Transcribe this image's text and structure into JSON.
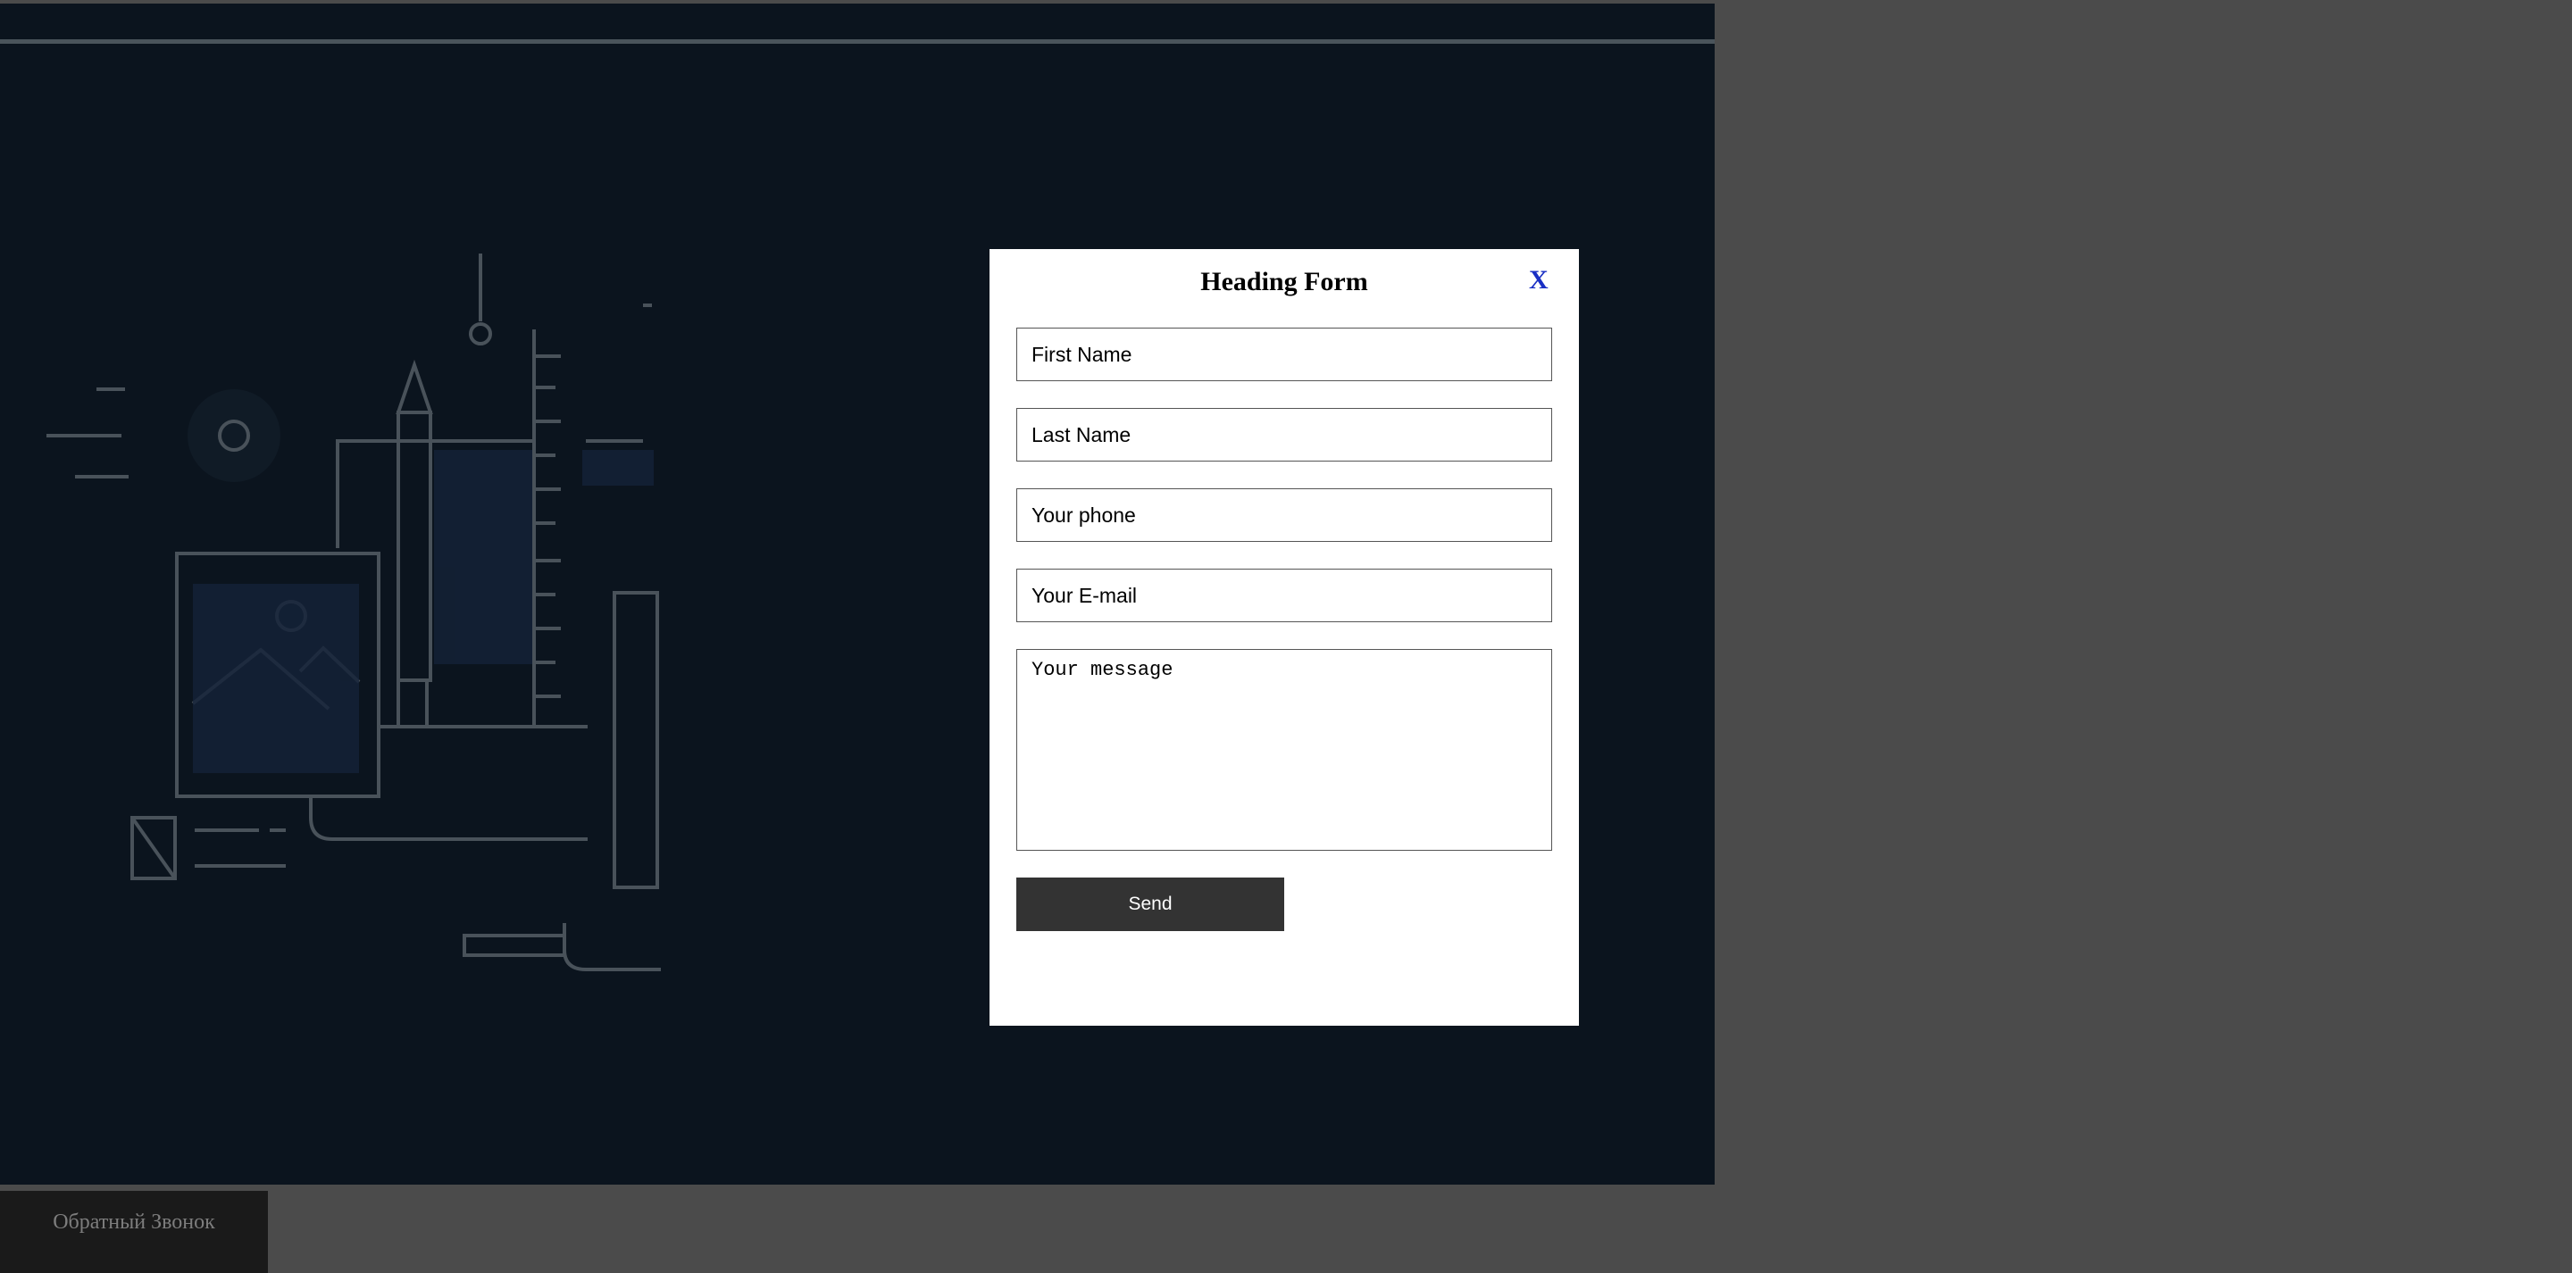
{
  "modal": {
    "title": "Heading Form",
    "close_label": "X",
    "fields": {
      "first_name_placeholder": "First Name",
      "last_name_placeholder": "Last Name",
      "phone_placeholder": "Your phone",
      "email_placeholder": "Your E-mail",
      "message_placeholder": "Your message"
    },
    "send_label": "Send"
  },
  "callback_tab": {
    "label": "Обратный Звонок"
  },
  "colors": {
    "overlay": "#4b4b4b",
    "page_background": "#0b141e",
    "close_link": "#1a2fc4",
    "send_button": "#333333"
  }
}
